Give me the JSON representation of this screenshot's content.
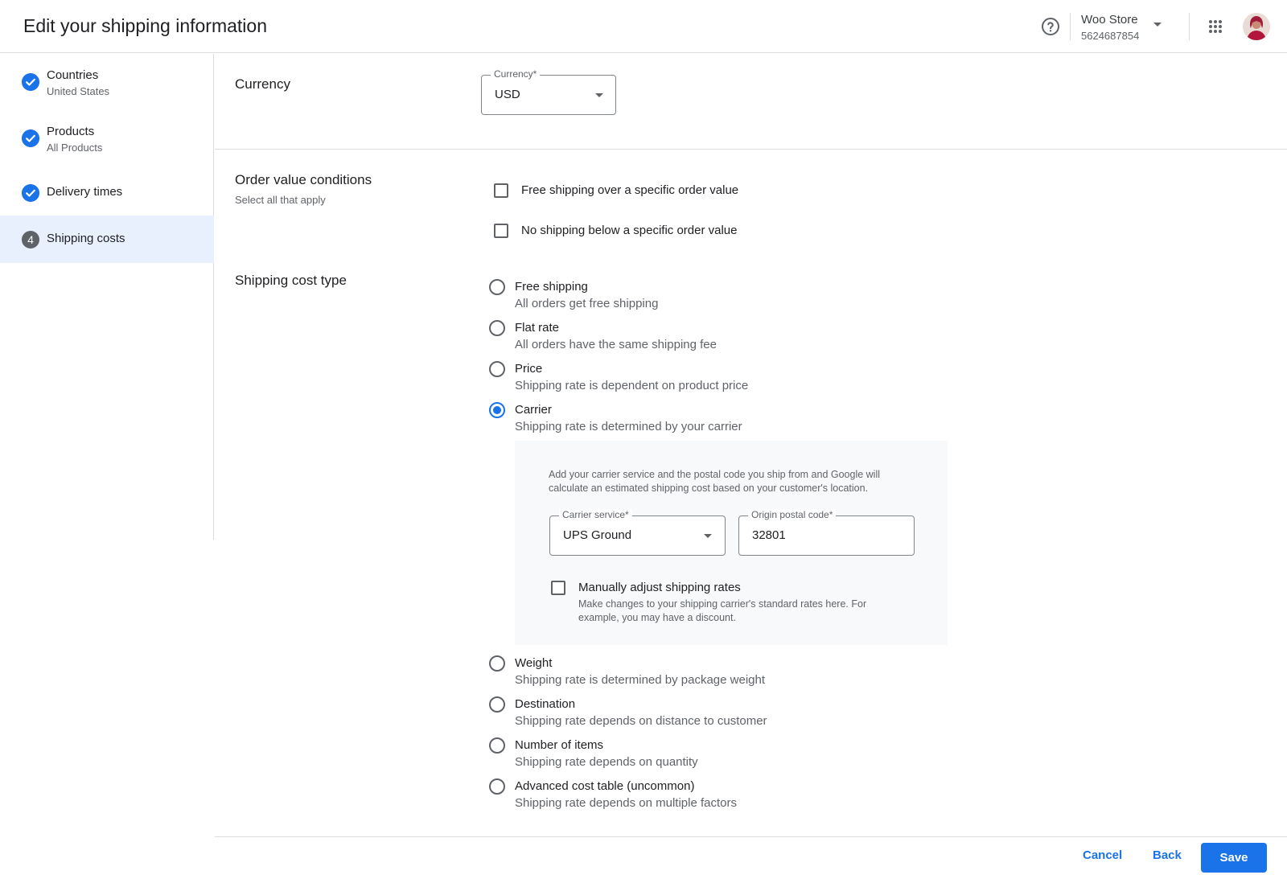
{
  "header": {
    "title": "Edit your shipping information",
    "account_name": "Woo Store",
    "account_id": "5624687854"
  },
  "sidebar": {
    "steps": [
      {
        "title": "Countries",
        "subtitle": "United States",
        "status": "done"
      },
      {
        "title": "Products",
        "subtitle": "All Products",
        "status": "done"
      },
      {
        "title": "Delivery times",
        "subtitle": "",
        "status": "done"
      },
      {
        "title": "Shipping costs",
        "subtitle": "",
        "status": "current",
        "number": "4"
      }
    ]
  },
  "currency": {
    "section_label": "Currency",
    "field_label": "Currency*",
    "value": "USD"
  },
  "order_conditions": {
    "section_label": "Order value conditions",
    "section_sub": "Select all that apply",
    "options": [
      {
        "label": "Free shipping over a specific order value",
        "checked": false
      },
      {
        "label": "No shipping below a specific order value",
        "checked": false
      }
    ]
  },
  "shipping_cost_type": {
    "section_label": "Shipping cost type",
    "selected": "Carrier",
    "options": [
      {
        "title": "Free shipping",
        "desc": "All orders get free shipping"
      },
      {
        "title": "Flat rate",
        "desc": "All orders have the same shipping fee"
      },
      {
        "title": "Price",
        "desc": "Shipping rate is dependent on product price"
      },
      {
        "title": "Carrier",
        "desc": "Shipping rate is determined by your carrier"
      },
      {
        "title": "Weight",
        "desc": "Shipping rate is determined by package weight"
      },
      {
        "title": "Destination",
        "desc": "Shipping rate depends on distance to customer"
      },
      {
        "title": "Number of items",
        "desc": "Shipping rate depends on quantity"
      },
      {
        "title": "Advanced cost table (uncommon)",
        "desc": "Shipping rate depends on multiple factors"
      }
    ]
  },
  "carrier_panel": {
    "info": "Add your carrier service and the postal code you ship from and Google will calculate an estimated shipping cost based on your customer's location.",
    "carrier_service_label": "Carrier service*",
    "carrier_service_value": "UPS Ground",
    "postal_code_label": "Origin postal code*",
    "postal_code_value": "32801",
    "manual_label": "Manually adjust shipping rates",
    "manual_desc": "Make changes to your shipping carrier's standard rates here. For example, you may have a discount.",
    "manual_checked": false
  },
  "footer": {
    "cancel_label": "Cancel",
    "back_label": "Back",
    "save_label": "Save"
  },
  "colors": {
    "accent": "#1a73e8",
    "active_step_bg": "#e8f0fe",
    "panel_bg": "#f8f9fa"
  }
}
